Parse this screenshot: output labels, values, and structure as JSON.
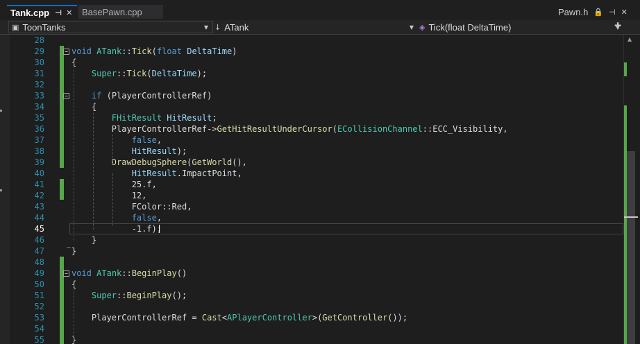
{
  "tabs": {
    "active": {
      "label": "Tank.cpp",
      "pin": "⊣",
      "close": "✕"
    },
    "inactive": {
      "label": "BasePawn.cpp"
    },
    "right": {
      "label": "Pawn.h",
      "lock": "🔒",
      "pin": "⊣",
      "close": "✕"
    }
  },
  "navbar": {
    "project": "ToonTanks",
    "class": "ATank",
    "function": "Tick(float DeltaTime)",
    "icons": {
      "project": "cpp-file-icon",
      "class": "down-arrow-icon",
      "function": "method-icon"
    }
  },
  "editor": {
    "current_line": 45,
    "colors": {
      "keyword": "#569cd6",
      "type": "#4ec9b0",
      "function": "#dcdcaa",
      "variable": "#9cdcfe",
      "change_bar": "#57a64a"
    },
    "lines": [
      {
        "n": "28",
        "tokens": []
      },
      {
        "n": "29",
        "tokens": [
          [
            "void",
            "kw"
          ],
          [
            " ",
            "pl"
          ],
          [
            "ATank",
            "ty"
          ],
          [
            "::",
            "pl"
          ],
          [
            "Tick",
            "fn"
          ],
          [
            "(",
            "pl"
          ],
          [
            "float",
            "kw"
          ],
          [
            " ",
            "pl"
          ],
          [
            "DeltaTime",
            "var"
          ],
          [
            ")",
            "pl"
          ]
        ]
      },
      {
        "n": "30",
        "tokens": [
          [
            "{",
            "pl"
          ]
        ]
      },
      {
        "n": "31",
        "tokens": [
          [
            "    ",
            "pl"
          ],
          [
            "Super",
            "ty"
          ],
          [
            "::",
            "pl"
          ],
          [
            "Tick",
            "fn"
          ],
          [
            "(",
            "pl"
          ],
          [
            "DeltaTime",
            "var"
          ],
          [
            ");",
            "pl"
          ]
        ]
      },
      {
        "n": "32",
        "tokens": []
      },
      {
        "n": "33",
        "tokens": [
          [
            "    ",
            "pl"
          ],
          [
            "if",
            "kw"
          ],
          [
            " (",
            "pl"
          ],
          [
            "PlayerControllerRef",
            "pl"
          ],
          [
            ")",
            "pl"
          ]
        ]
      },
      {
        "n": "34",
        "tokens": [
          [
            "    ",
            "pl"
          ],
          [
            "{",
            "pl"
          ]
        ]
      },
      {
        "n": "35",
        "tokens": [
          [
            "        ",
            "pl"
          ],
          [
            "FHitResult",
            "ty"
          ],
          [
            " ",
            "pl"
          ],
          [
            "HitResult",
            "var"
          ],
          [
            ";",
            "pl"
          ]
        ]
      },
      {
        "n": "36",
        "tokens": [
          [
            "        ",
            "pl"
          ],
          [
            "PlayerControllerRef",
            "pl"
          ],
          [
            "->",
            "pl"
          ],
          [
            "GetHitResultUnderCursor",
            "fn"
          ],
          [
            "(",
            "pl"
          ],
          [
            "ECollisionChannel",
            "ty"
          ],
          [
            "::",
            "pl"
          ],
          [
            "ECC_Visibility",
            "pl"
          ],
          [
            ",",
            "pl"
          ]
        ]
      },
      {
        "n": "37",
        "tokens": [
          [
            "            ",
            "pl"
          ],
          [
            "false",
            "kw"
          ],
          [
            ",",
            "pl"
          ]
        ]
      },
      {
        "n": "38",
        "tokens": [
          [
            "            ",
            "pl"
          ],
          [
            "HitResult",
            "var"
          ],
          [
            ");",
            "pl"
          ]
        ]
      },
      {
        "n": "39",
        "tokens": [
          [
            "        ",
            "pl"
          ],
          [
            "DrawDebugSphere",
            "fn"
          ],
          [
            "(",
            "pl"
          ],
          [
            "GetWorld",
            "fn"
          ],
          [
            "(),",
            "pl"
          ]
        ]
      },
      {
        "n": "40",
        "tokens": [
          [
            "            ",
            "pl"
          ],
          [
            "HitResult",
            "var"
          ],
          [
            ".",
            "pl"
          ],
          [
            "ImpactPoint",
            "pl"
          ],
          [
            ",",
            "pl"
          ]
        ]
      },
      {
        "n": "41",
        "tokens": [
          [
            "            ",
            "pl"
          ],
          [
            "25.f",
            "pl"
          ],
          [
            ",",
            "pl"
          ]
        ]
      },
      {
        "n": "42",
        "tokens": [
          [
            "            ",
            "pl"
          ],
          [
            "12",
            "pl"
          ],
          [
            ",",
            "pl"
          ]
        ]
      },
      {
        "n": "43",
        "tokens": [
          [
            "            ",
            "pl"
          ],
          [
            "FColor",
            "pl"
          ],
          [
            "::",
            "pl"
          ],
          [
            "Red",
            "pl"
          ],
          [
            ",",
            "pl"
          ]
        ]
      },
      {
        "n": "44",
        "tokens": [
          [
            "            ",
            "pl"
          ],
          [
            "false",
            "kw"
          ],
          [
            ",",
            "pl"
          ]
        ]
      },
      {
        "n": "45",
        "tokens": [
          [
            "            ",
            "pl"
          ],
          [
            "-1.f",
            "pl"
          ],
          [
            ");",
            "pl"
          ]
        ]
      },
      {
        "n": "46",
        "tokens": [
          [
            "    ",
            "pl"
          ],
          [
            "}",
            "pl"
          ]
        ]
      },
      {
        "n": "47",
        "tokens": [
          [
            "}",
            "pl"
          ]
        ]
      },
      {
        "n": "48",
        "tokens": []
      },
      {
        "n": "49",
        "tokens": [
          [
            "void",
            "kw"
          ],
          [
            " ",
            "pl"
          ],
          [
            "ATank",
            "ty"
          ],
          [
            "::",
            "pl"
          ],
          [
            "BeginPlay",
            "fn"
          ],
          [
            "()",
            "pl"
          ]
        ]
      },
      {
        "n": "50",
        "tokens": [
          [
            "{",
            "pl"
          ]
        ]
      },
      {
        "n": "51",
        "tokens": [
          [
            "    ",
            "pl"
          ],
          [
            "Super",
            "ty"
          ],
          [
            "::",
            "pl"
          ],
          [
            "BeginPlay",
            "fn"
          ],
          [
            "();",
            "pl"
          ]
        ]
      },
      {
        "n": "52",
        "tokens": []
      },
      {
        "n": "53",
        "tokens": [
          [
            "    ",
            "pl"
          ],
          [
            "PlayerControllerRef",
            "pl"
          ],
          [
            " = ",
            "pl"
          ],
          [
            "Cast",
            "fn"
          ],
          [
            "<",
            "pl"
          ],
          [
            "APlayerController",
            "ty"
          ],
          [
            ">(",
            "pl"
          ],
          [
            "GetController",
            "fn"
          ],
          [
            "());",
            "pl"
          ]
        ]
      },
      {
        "n": "54",
        "tokens": []
      },
      {
        "n": "55",
        "tokens": [
          [
            "}",
            "pl"
          ]
        ]
      }
    ]
  },
  "fold_glyph": "−"
}
